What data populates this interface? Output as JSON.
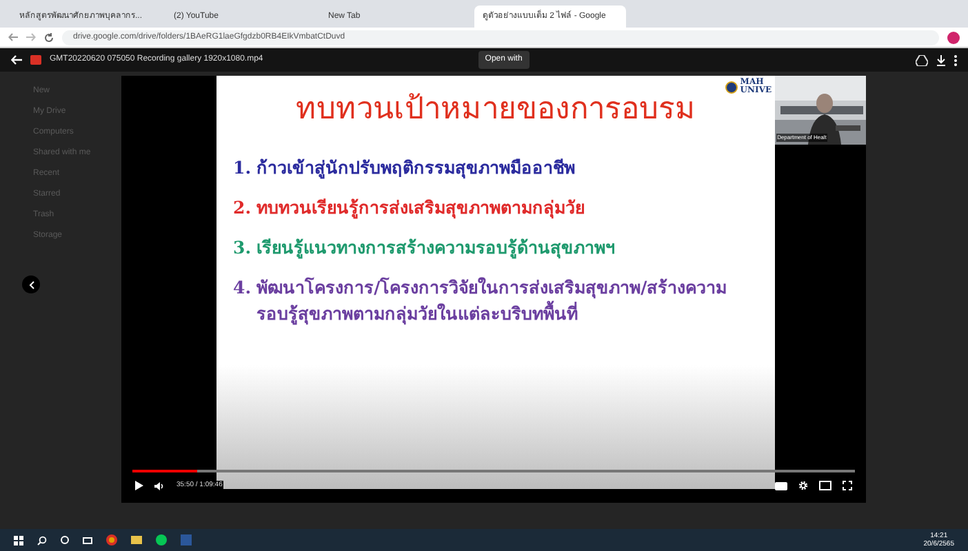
{
  "browser_tabs": [
    {
      "title": "หลักสูตรพัฒนาศักยภาพบุคลากร...",
      "selected": false
    },
    {
      "title": "(2) YouTube",
      "selected": false
    },
    {
      "title": "New Tab",
      "selected": false
    },
    {
      "title": "ดูตัวอย่างแบบเต็ม 2 ไฟล์ - Google",
      "selected": true
    }
  ],
  "address_bar": {
    "url": "drive.google.com/drive/folders/1BAeRG1laeGfgdzb0RB4EIkVmbatCtDuvd"
  },
  "viewer": {
    "file_name": "GMT20220620 075050 Recording gallery 1920x1080.mp4",
    "open_with": "Open with"
  },
  "sidebar": {
    "items": [
      {
        "label": "New"
      },
      {
        "label": "My Drive"
      },
      {
        "label": "Computers"
      },
      {
        "label": "Shared with me"
      },
      {
        "label": "Recent"
      },
      {
        "label": "Starred"
      },
      {
        "label": "Trash"
      },
      {
        "label": "Storage"
      }
    ]
  },
  "slide": {
    "title": "ทบทวนเป้าหมายของการอบรม",
    "logo_text": [
      "MAH",
      "UNIVE"
    ],
    "points": [
      {
        "number": "1.",
        "text": "ก้าวเข้าสู่นักปรับพฤติกรรมสุขภาพมืออาชีพ",
        "color": "#2b2b9e"
      },
      {
        "number": "2.",
        "text": "ทบทวนเรียนรู้การส่งเสริมสุขภาพตามกลุ่มวัย",
        "color": "#e02b2b"
      },
      {
        "number": "3.",
        "text": "เรียนรู้แนวทางการสร้างความรอบรู้ด้านสุขภาพฯ",
        "color": "#1f9a6e"
      },
      {
        "number": "4.",
        "text": "พัฒนาโครงการ/โครงการวิจัยในการส่งเสริมสุขภาพ/สร้างความรอบรู้สุขภาพตามกลุ่มวัยในแต่ละบริบทพื้นที่",
        "color": "#6b3fa0"
      }
    ],
    "webcam_label": "Department of Healt"
  },
  "player": {
    "level": 0.09,
    "time": "35:50 / 1:09:46"
  },
  "taskbar": {
    "time": "14:21",
    "date": "20/6/2565"
  }
}
